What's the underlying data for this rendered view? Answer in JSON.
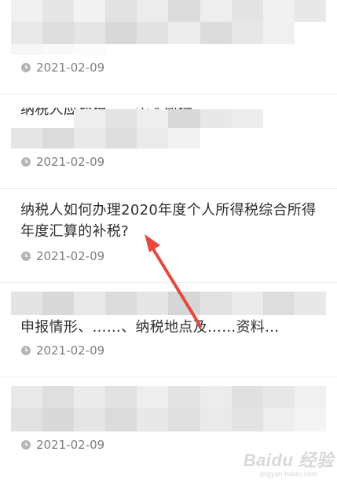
{
  "articles": [
    {
      "title": "",
      "date": "2021-02-09",
      "blurred": true
    },
    {
      "title": "纳税人应补税……个人所得",
      "date": "2021-02-09",
      "blurred": true
    },
    {
      "title": "纳税人如何办理2020年度个人所得税综合所得年度汇算的补税?",
      "date": "2021-02-09",
      "blurred": false
    },
    {
      "title": "申报情形、……、纳税地点及……资料…",
      "date": "2021-02-09",
      "blurred": true
    },
    {
      "title": "",
      "date": "2021-02-09",
      "blurred": true
    }
  ],
  "annotation": {
    "type": "red-arrow",
    "points_to": "article-3-title",
    "color": "#e8473f"
  },
  "watermark": {
    "logo": "Baidu 经验",
    "sub": "jingyan.baidu.com"
  }
}
